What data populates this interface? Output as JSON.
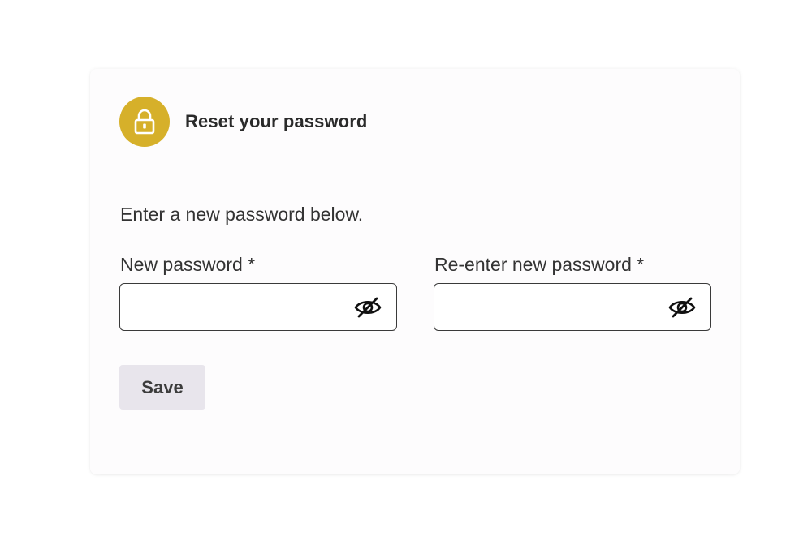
{
  "header": {
    "title": "Reset your password",
    "icon": "lock-icon",
    "icon_bg_color": "#d6b02a"
  },
  "intro_text": "Enter a new password below.",
  "fields": [
    {
      "label": "New password *",
      "value": "",
      "placeholder": "",
      "toggle_icon": "eye-slash-icon"
    },
    {
      "label": "Re-enter new password *",
      "value": "",
      "placeholder": "",
      "toggle_icon": "eye-slash-icon"
    }
  ],
  "actions": {
    "save_label": "Save",
    "save_bg_color": "#e8e5ec"
  }
}
